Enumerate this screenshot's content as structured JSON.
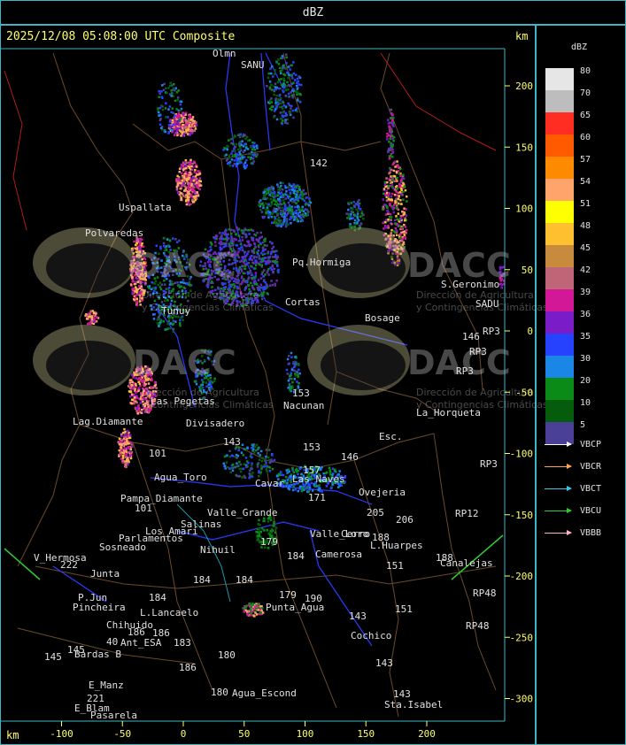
{
  "header": {
    "title": "dBZ"
  },
  "map": {
    "title": "2025/12/08 05:08:00 UTC Composite",
    "km_label": "km",
    "x_ticks": [
      "-100",
      "-50",
      "0",
      "50",
      "100",
      "150",
      "200"
    ],
    "y_ticks": [
      "200",
      "150",
      "100",
      "50",
      "0",
      "-50",
      "-100",
      "-150",
      "-200",
      "-250",
      "-300"
    ],
    "watermark": [
      "DACC",
      "DACC",
      "DACC",
      "DACC"
    ],
    "watermark_sub": [
      "Dirección de Agricultura",
      "y Contingencias Climáticas"
    ],
    "places": [
      {
        "t": "Olmn",
        "x": 240,
        "y": 64
      },
      {
        "t": "SANU",
        "x": 272,
        "y": 77
      },
      {
        "t": "Uspallata",
        "x": 134,
        "y": 238
      },
      {
        "t": "Polvaredas",
        "x": 96,
        "y": 267
      },
      {
        "t": "S.Geronimo",
        "x": 498,
        "y": 325
      },
      {
        "t": "SADU",
        "x": 537,
        "y": 347
      },
      {
        "t": "Bosage",
        "x": 412,
        "y": 363
      },
      {
        "t": "Cortas",
        "x": 322,
        "y": 345
      },
      {
        "t": "RP3",
        "x": 545,
        "y": 378
      },
      {
        "t": "146",
        "x": 522,
        "y": 384
      },
      {
        "t": "RP3",
        "x": 530,
        "y": 401
      },
      {
        "t": "RP3",
        "x": 515,
        "y": 423
      },
      {
        "t": "153",
        "x": 330,
        "y": 448
      },
      {
        "t": "Nacunan",
        "x": 320,
        "y": 462
      },
      {
        "t": "La_Horqueta",
        "x": 470,
        "y": 470
      },
      {
        "t": "Las Pegetas",
        "x": 170,
        "y": 457
      },
      {
        "t": "Lag.Diamante",
        "x": 82,
        "y": 480
      },
      {
        "t": "Divisadero",
        "x": 210,
        "y": 482
      },
      {
        "t": "143",
        "x": 252,
        "y": 503
      },
      {
        "t": "153",
        "x": 342,
        "y": 509
      },
      {
        "t": "Esc.",
        "x": 428,
        "y": 497
      },
      {
        "t": "146",
        "x": 385,
        "y": 520
      },
      {
        "t": "101",
        "x": 168,
        "y": 516
      },
      {
        "t": "RP3",
        "x": 542,
        "y": 528
      },
      {
        "t": "Agua_Toro",
        "x": 174,
        "y": 543
      },
      {
        "t": "Pampa_Diamante",
        "x": 136,
        "y": 567
      },
      {
        "t": "101",
        "x": 152,
        "y": 578
      },
      {
        "t": "Ovejeria",
        "x": 405,
        "y": 560
      },
      {
        "t": "Valle_Grande",
        "x": 234,
        "y": 583
      },
      {
        "t": "205",
        "x": 414,
        "y": 583
      },
      {
        "t": "206",
        "x": 447,
        "y": 591
      },
      {
        "t": "RP12",
        "x": 514,
        "y": 584
      },
      {
        "t": "Salinas",
        "x": 204,
        "y": 596
      },
      {
        "t": "Los_Amari",
        "x": 164,
        "y": 604
      },
      {
        "t": "Parlamentos",
        "x": 134,
        "y": 612
      },
      {
        "t": "Sosneado",
        "x": 112,
        "y": 622
      },
      {
        "t": "Nihuil",
        "x": 226,
        "y": 625
      },
      {
        "t": "179",
        "x": 294,
        "y": 616
      },
      {
        "t": "188",
        "x": 420,
        "y": 611
      },
      {
        "t": "L.Huarpes",
        "x": 418,
        "y": 620
      },
      {
        "t": "Camerosa",
        "x": 356,
        "y": 630
      },
      {
        "t": "184",
        "x": 324,
        "y": 632
      },
      {
        "t": "V_Hermosa",
        "x": 38,
        "y": 634
      },
      {
        "t": "222",
        "x": 68,
        "y": 642
      },
      {
        "t": "151",
        "x": 436,
        "y": 643
      },
      {
        "t": "188",
        "x": 492,
        "y": 634
      },
      {
        "t": "Canalejas",
        "x": 497,
        "y": 640
      },
      {
        "t": "Junta",
        "x": 102,
        "y": 652
      },
      {
        "t": "184",
        "x": 218,
        "y": 659
      },
      {
        "t": "184",
        "x": 266,
        "y": 659
      },
      {
        "t": "P.Jun",
        "x": 88,
        "y": 679
      },
      {
        "t": "184",
        "x": 168,
        "y": 679
      },
      {
        "t": "179",
        "x": 315,
        "y": 676
      },
      {
        "t": "190",
        "x": 344,
        "y": 680
      },
      {
        "t": "RP48",
        "x": 534,
        "y": 674
      },
      {
        "t": "Pincheira",
        "x": 82,
        "y": 690
      },
      {
        "t": "Punta_Agua",
        "x": 300,
        "y": 690
      },
      {
        "t": "L.Lancaelo",
        "x": 158,
        "y": 696
      },
      {
        "t": "151",
        "x": 446,
        "y": 692
      },
      {
        "t": "143",
        "x": 394,
        "y": 700
      },
      {
        "t": "Chihuido",
        "x": 120,
        "y": 710
      },
      {
        "t": "186",
        "x": 144,
        "y": 718
      },
      {
        "t": "186",
        "x": 172,
        "y": 719
      },
      {
        "t": "RP48",
        "x": 526,
        "y": 711
      },
      {
        "t": "Cochico",
        "x": 396,
        "y": 722
      },
      {
        "t": "40",
        "x": 120,
        "y": 729
      },
      {
        "t": "Ant_ESA",
        "x": 136,
        "y": 730
      },
      {
        "t": "183",
        "x": 196,
        "y": 730
      },
      {
        "t": "145",
        "x": 50,
        "y": 746
      },
      {
        "t": "145",
        "x": 76,
        "y": 738
      },
      {
        "t": "Bardas B",
        "x": 84,
        "y": 743
      },
      {
        "t": "180",
        "x": 246,
        "y": 744
      },
      {
        "t": "186",
        "x": 202,
        "y": 758
      },
      {
        "t": "143",
        "x": 424,
        "y": 753
      },
      {
        "t": "E_Manz",
        "x": 100,
        "y": 778
      },
      {
        "t": "180",
        "x": 238,
        "y": 786
      },
      {
        "t": "Agua_Escond",
        "x": 262,
        "y": 787
      },
      {
        "t": "143",
        "x": 444,
        "y": 788
      },
      {
        "t": "221",
        "x": 98,
        "y": 793
      },
      {
        "t": "E_Blam",
        "x": 84,
        "y": 804
      },
      {
        "t": "Sta.Isabel",
        "x": 434,
        "y": 800
      },
      {
        "t": "Pasarela",
        "x": 102,
        "y": 812
      },
      {
        "t": "Pq.Hormiga",
        "x": 330,
        "y": 300
      },
      {
        "t": "Tunuy",
        "x": 182,
        "y": 355
      },
      {
        "t": "Cavar",
        "x": 288,
        "y": 550
      },
      {
        "t": "171",
        "x": 348,
        "y": 566
      },
      {
        "t": "157",
        "x": 342,
        "y": 535
      },
      {
        "t": "Las Naves",
        "x": 330,
        "y": 545
      },
      {
        "t": "Valle_Loro",
        "x": 350,
        "y": 607
      },
      {
        "t": "Cerro",
        "x": 385,
        "y": 607
      },
      {
        "t": "142",
        "x": 350,
        "y": 188
      }
    ]
  },
  "legend": {
    "title": "dBZ",
    "levels": [
      {
        "value": "80",
        "color": "#e6e6e6"
      },
      {
        "value": "70",
        "color": "#bdbdbd"
      },
      {
        "value": "65",
        "color": "#ff2d22"
      },
      {
        "value": "60",
        "color": "#ff5a00"
      },
      {
        "value": "57",
        "color": "#ff8a00"
      },
      {
        "value": "54",
        "color": "#ffa46a"
      },
      {
        "value": "51",
        "color": "#ffff00"
      },
      {
        "value": "48",
        "color": "#ffc030"
      },
      {
        "value": "45",
        "color": "#c88a3c"
      },
      {
        "value": "42",
        "color": "#c06478"
      },
      {
        "value": "39",
        "color": "#d21896"
      },
      {
        "value": "36",
        "color": "#7a1cc8"
      },
      {
        "value": "35",
        "color": "#2642ff"
      },
      {
        "value": "30",
        "color": "#1a86e6"
      },
      {
        "value": "20",
        "color": "#0a8a16"
      },
      {
        "value": "10",
        "color": "#045c0c"
      },
      {
        "value": "5",
        "color": "#4a4098"
      }
    ],
    "radars": [
      {
        "name": "VBCP",
        "color": "#ffffff"
      },
      {
        "name": "VBCR",
        "color": "#ffa640"
      },
      {
        "name": "VBCT",
        "color": "#36c8e6"
      },
      {
        "name": "VBCU",
        "color": "#2ecc2e"
      },
      {
        "name": "VBBB",
        "color": "#ffb0c8"
      }
    ]
  },
  "footer": {
    "km_label": "km"
  }
}
